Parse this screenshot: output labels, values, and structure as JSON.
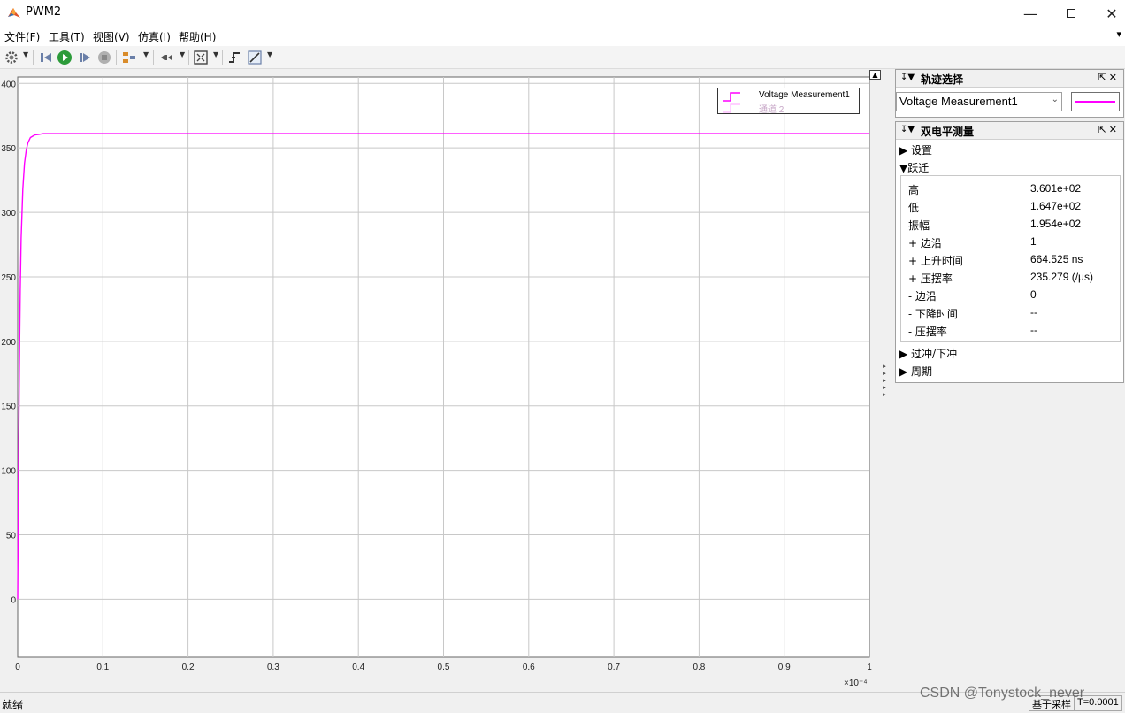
{
  "window": {
    "title": "PWM2"
  },
  "menu": {
    "items": [
      "文件(F)",
      "工具(T)",
      "视图(V)",
      "仿真(I)",
      "帮助(H)"
    ],
    "overflow": "▾"
  },
  "toolbar": {
    "buttons": [
      "settings-icon",
      "step-back-icon",
      "run-icon",
      "step-forward-icon",
      "stop-icon",
      "highlight-icon",
      "zoom-cursor-icon",
      "fit-axes-icon",
      "triggers-icon",
      "measurements-icon"
    ]
  },
  "plot": {
    "x_multiplier": "×10⁻⁴",
    "line_color": "#ff00ff"
  },
  "chart_data": {
    "type": "line",
    "xlim": [
      0,
      1
    ],
    "ylim": [
      -45,
      405
    ],
    "x_ticks": [
      "0",
      "0.1",
      "0.2",
      "0.3",
      "0.4",
      "0.5",
      "0.6",
      "0.7",
      "0.8",
      "0.9",
      "1"
    ],
    "x_tick_values": [
      0,
      0.1,
      0.2,
      0.3,
      0.4,
      0.5,
      0.6,
      0.7,
      0.8,
      0.9,
      1
    ],
    "y_ticks": [
      "0",
      "50",
      "100",
      "150",
      "200",
      "250",
      "300",
      "350",
      "400"
    ],
    "y_tick_values": [
      0,
      50,
      100,
      150,
      200,
      250,
      300,
      350,
      400
    ],
    "grid": true,
    "legend_position": "top-right",
    "series": [
      {
        "name": "Voltage Measurement1",
        "color": "#ff00ff",
        "x": [
          0,
          0.001,
          0.002,
          0.003,
          0.004,
          0.006,
          0.008,
          0.01,
          0.012,
          0.015,
          0.02,
          0.025,
          0.03,
          0.04,
          0.05,
          0.1,
          0.2,
          0.3,
          0.4,
          0.5,
          0.6,
          0.7,
          0.8,
          0.9,
          1
        ],
        "y": [
          0,
          110,
          180,
          240,
          280,
          318,
          338,
          348,
          354,
          358,
          360,
          360.5,
          361,
          361,
          361,
          361,
          361,
          361,
          361,
          361,
          361,
          361,
          361,
          361,
          361
        ]
      },
      {
        "name": "通道 2",
        "color": "#ffb3ff",
        "x": [],
        "y": []
      }
    ]
  },
  "trace_panel": {
    "title": "轨迹选择",
    "selected": "Voltage Measurement1",
    "color": "#ff00ff"
  },
  "meas_panel": {
    "title": "双电平测量",
    "sections": {
      "settings": "▶ 设置",
      "transitions": "▼跃迁",
      "overshoot": "▶ 过冲/下冲",
      "period": "▶ 周期"
    },
    "rows": [
      {
        "label": "高",
        "value": "3.601e+02"
      },
      {
        "label": "低",
        "value": "1.647e+02"
      },
      {
        "label": "振幅",
        "value": "1.954e+02"
      },
      {
        "label": "+ 边沿",
        "value": "1"
      },
      {
        "label": "+ 上升时间",
        "value": "664.525 ns"
      },
      {
        "label": "+ 压摆率",
        "value": "235.279 (/μs)"
      },
      {
        "label": "- 边沿",
        "value": "0"
      },
      {
        "label": "- 下降时间",
        "value": "--"
      },
      {
        "label": "- 压摆率",
        "value": "--"
      }
    ]
  },
  "status": {
    "ready": "就绪",
    "mode": "基于采样",
    "time": "T=0.0001"
  },
  "watermark": "CSDN @Tonystock_never"
}
